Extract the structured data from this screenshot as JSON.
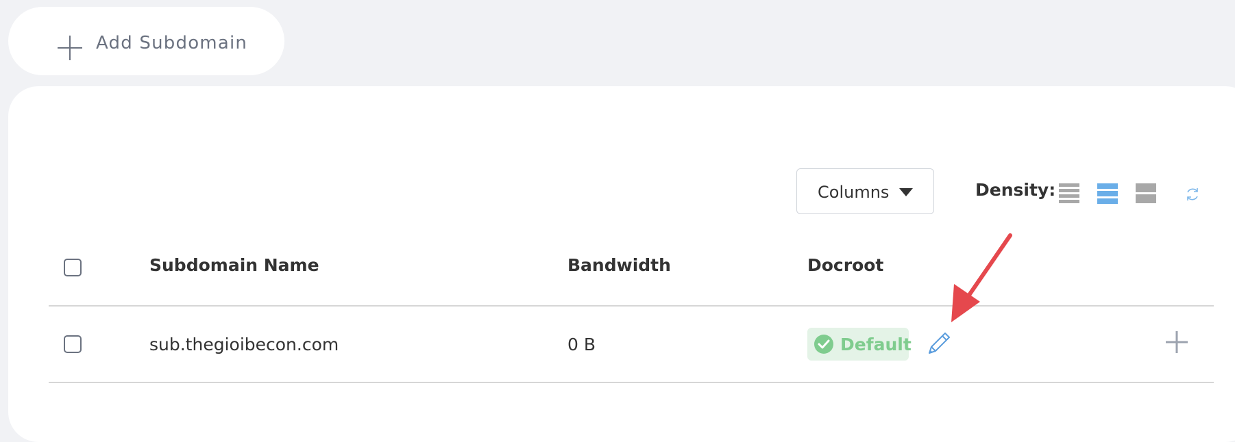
{
  "toolbar": {
    "add_subdomain_label": "Add Subdomain",
    "columns_label": "Columns",
    "density_label": "Density:",
    "density_options": [
      "compact-density-icon",
      "standard-density-icon",
      "comfortable-density-icon"
    ],
    "density_selected": "standard",
    "refresh_icon": "refresh-icon"
  },
  "table": {
    "headers": {
      "name": "Subdomain Name",
      "bandwidth": "Bandwidth",
      "docroot": "Docroot"
    },
    "rows": [
      {
        "name": "sub.thegioibecon.com",
        "bandwidth": "0 B",
        "docroot_badge": "Default"
      }
    ]
  },
  "colors": {
    "background": "#f1f2f5",
    "card": "#ffffff",
    "accent_blue": "#6aaee8",
    "badge_bg": "#e4f3e7",
    "badge_text": "#7fcc8e",
    "annotation_arrow": "#e5484d"
  }
}
